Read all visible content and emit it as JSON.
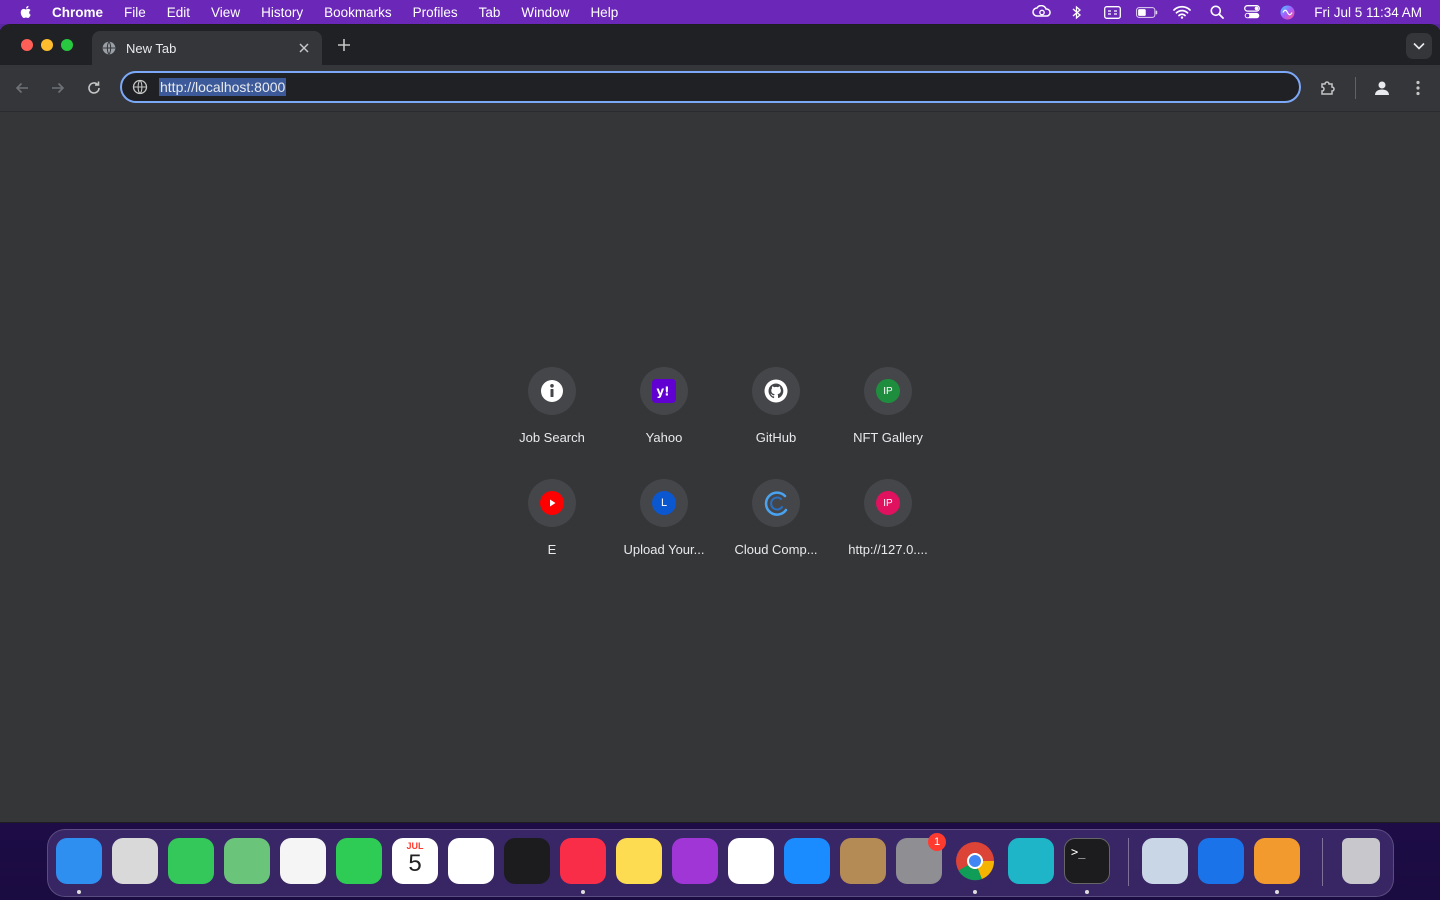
{
  "menubar": {
    "app_name": "Chrome",
    "items": [
      "File",
      "Edit",
      "View",
      "History",
      "Bookmarks",
      "Profiles",
      "Tab",
      "Window",
      "Help"
    ],
    "status_icons": [
      "creative-cloud-icon",
      "bluetooth-icon",
      "keyboard-input-icon",
      "battery-icon",
      "wifi-icon",
      "spotlight-search-icon",
      "control-center-icon",
      "siri-icon"
    ],
    "clock": "Fri Jul 5  11:34 AM"
  },
  "browser": {
    "tab": {
      "title": "New Tab",
      "favicon": "globe-icon"
    },
    "omnibox": {
      "url": "http://localhost:8000"
    }
  },
  "shortcuts": [
    {
      "label": "Job Search",
      "icon": "info-icon",
      "color": "#ffffff"
    },
    {
      "label": "Yahoo",
      "icon": "yahoo-icon",
      "color": "#6001d2"
    },
    {
      "label": "GitHub",
      "icon": "github-icon",
      "color": "#ffffff"
    },
    {
      "label": "NFT Gallery",
      "icon": "ip-icon",
      "letter": "IP",
      "color": "#1e8e3e"
    },
    {
      "label": "E",
      "icon": "youtube-icon",
      "color": "#ff0000"
    },
    {
      "label": "Upload Your...",
      "icon": "letter-l-icon",
      "letter": "L",
      "color": "#0b57d0"
    },
    {
      "label": "Cloud Comp...",
      "icon": "cloud-arc-icon",
      "color": "#4aa3f0"
    },
    {
      "label": "http://127.0....",
      "icon": "ip-icon",
      "letter": "IP",
      "color": "#e0115f"
    }
  ],
  "dock": {
    "apps": [
      {
        "name": "finder-icon",
        "color": "#2f8ff0",
        "running": true
      },
      {
        "name": "launchpad-icon",
        "color": "#d9d9d9",
        "running": false
      },
      {
        "name": "messages-icon",
        "color": "#34c759",
        "running": false
      },
      {
        "name": "maps-icon",
        "color": "#6ac47a",
        "running": false
      },
      {
        "name": "photos-icon",
        "color": "#f5f5f5",
        "running": false
      },
      {
        "name": "facetime-icon",
        "color": "#2ecc55",
        "running": false
      },
      {
        "name": "calendar-icon",
        "color": "#ffffff",
        "running": false,
        "month": "JUL",
        "day": "5"
      },
      {
        "name": "reminders-icon",
        "color": "#ffffff",
        "running": false
      },
      {
        "name": "apple-tv-icon",
        "color": "#1c1c1e",
        "running": false
      },
      {
        "name": "music-icon",
        "color": "#fa2d48",
        "running": true
      },
      {
        "name": "notes-icon",
        "color": "#fddc52",
        "running": false
      },
      {
        "name": "podcasts-icon",
        "color": "#a036d6",
        "running": false
      },
      {
        "name": "news-icon",
        "color": "#ffffff",
        "running": false
      },
      {
        "name": "app-store-icon",
        "color": "#1a8cff",
        "running": false
      },
      {
        "name": "contacts-icon",
        "color": "#b58b55",
        "running": false
      },
      {
        "name": "system-settings-icon",
        "color": "#8e8e93",
        "running": false,
        "badge": "1"
      },
      {
        "name": "chrome-icon",
        "color": "#ffffff",
        "running": true
      },
      {
        "name": "cursor-app-icon",
        "color": "#1fb5c9",
        "running": false
      },
      {
        "name": "terminal-icon",
        "color": "#1c1c1e",
        "running": true
      },
      {
        "name": "preview-icon",
        "color": "#c9d6e6",
        "running": false
      },
      {
        "name": "suite-app-icon",
        "color": "#1a73e8",
        "running": false
      },
      {
        "name": "sunset-image-icon",
        "color": "#f29a2e",
        "running": true
      },
      {
        "name": "trash-icon",
        "color": "#c8c8cc",
        "running": false
      }
    ]
  }
}
